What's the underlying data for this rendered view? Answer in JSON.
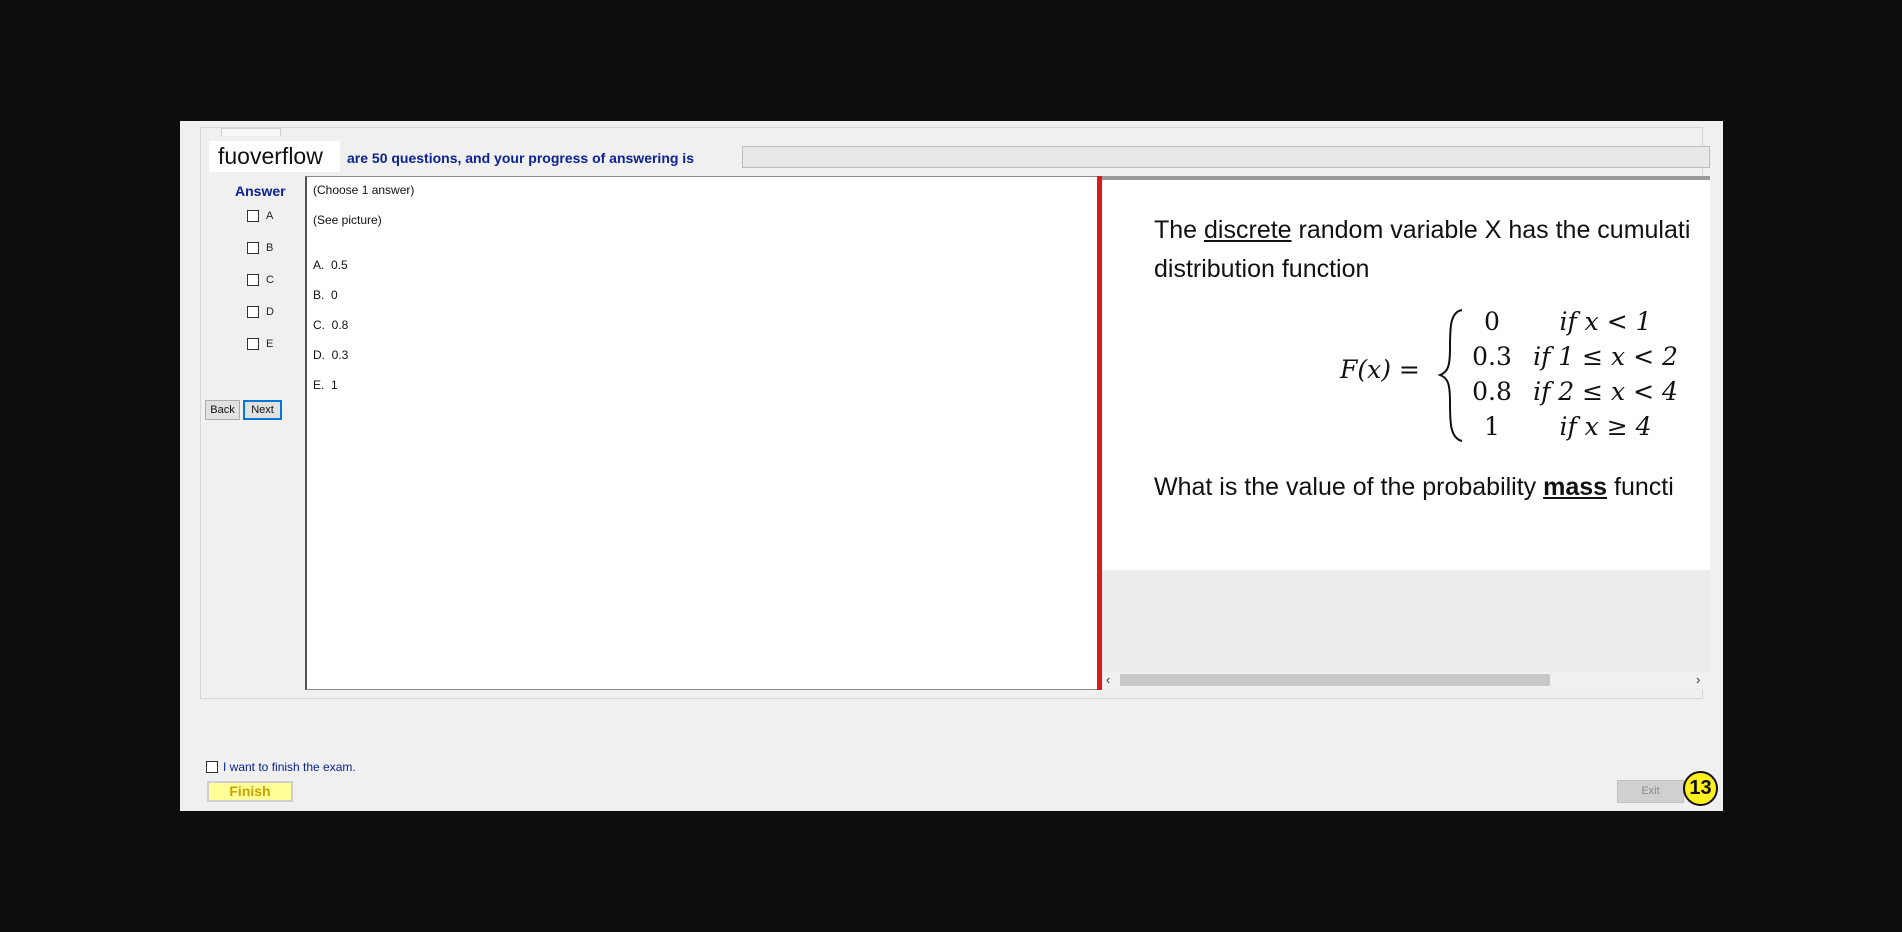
{
  "brand": "fuoverflow",
  "progress": {
    "label": "are 50 questions, and your progress of answering is",
    "value_percent": 0
  },
  "answer_panel": {
    "title": "Answer",
    "options": [
      "A",
      "B",
      "C",
      "D",
      "E"
    ],
    "back_label": "Back",
    "next_label": "Next"
  },
  "question": {
    "instruction": "(Choose 1 answer)",
    "body": "(See picture)",
    "choices": [
      "A.  0.5",
      "B.  0",
      "C.  0.8",
      "D.  0.3",
      "E.  1"
    ]
  },
  "image": {
    "line1_pre": "The ",
    "line1_underlined": "discrete",
    "line1_post": " random variable X has the cumulati",
    "line2": "distribution function",
    "lhs": "F(x) =",
    "cases": [
      {
        "value": "0",
        "condition": "if x < 1"
      },
      {
        "value": "0.3",
        "condition": "if 1 ≤ x < 2"
      },
      {
        "value": "0.8",
        "condition": "if 2 ≤ x < 4"
      },
      {
        "value": "1",
        "condition": "if x ≥ 4"
      }
    ],
    "line3_pre": "What is the value of the",
    "line3_word": "probability",
    "line3_bold": "mass",
    "line3_post": "functi"
  },
  "footer": {
    "finish_check_label": "I want to finish the exam.",
    "finish_label": "Finish",
    "exit_label": "Exit",
    "badge": "13"
  },
  "colors": {
    "accent": "#0b2290",
    "divider": "#d71a1a",
    "finish_bg": "#ffff99",
    "badge": "#ffef1f"
  }
}
